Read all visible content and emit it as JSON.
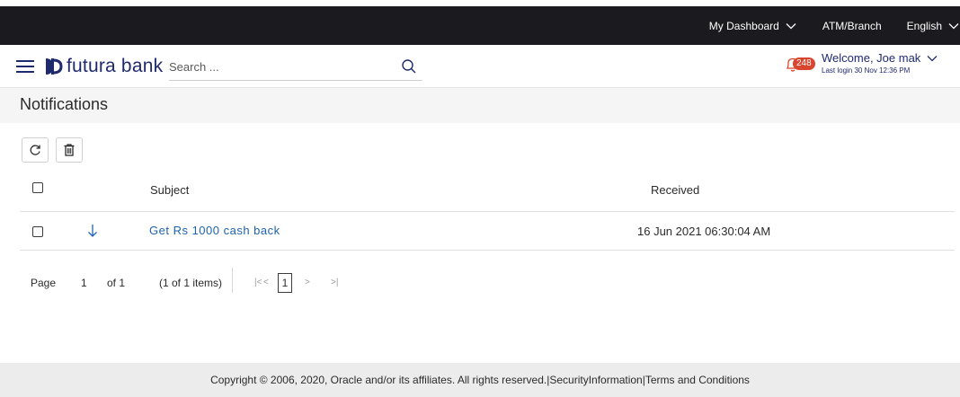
{
  "topbar": {
    "dashboard_label": "My Dashboard",
    "atm_branch_label": "ATM/Branch",
    "language_label": "English"
  },
  "header": {
    "brand_name": "futura bank",
    "search_placeholder": "Search ...",
    "notification_count": "248",
    "welcome_text": "Welcome, Joe mak",
    "last_login": "Last login 30 Nov 12:36 PM"
  },
  "page": {
    "title": "Notifications"
  },
  "toolbar": {
    "refresh_icon": "refresh-icon",
    "delete_icon": "trash-icon"
  },
  "table": {
    "columns": [
      "Subject",
      "Received"
    ],
    "rows": [
      {
        "direction_icon": "arrow-down-icon",
        "subject": "Get Rs 1000 cash back",
        "received": "16 Jun 2021 06:30:04 AM"
      }
    ]
  },
  "pagination": {
    "page_label": "Page",
    "current_page": "1",
    "of_label": "of 1",
    "items_summary": "(1 of 1 items)",
    "first_symbol": "|<",
    "prev_symbol": "<",
    "next_symbol": ">",
    "last_symbol": ">|"
  },
  "footer": {
    "copyright": "Copyright © 2006, 2020, Oracle and/or its affiliates. All rights reserved.",
    "security_link": "SecurityInformation",
    "terms_link": "Terms and Conditions",
    "separator": "|"
  },
  "colors": {
    "topbar_bg": "#1a1a1f",
    "brand_blue": "#1f2a6e",
    "link_blue": "#1e62b0",
    "badge_red": "#d8462f",
    "content_bg": "#f5f5f5",
    "footer_bg": "#ececec"
  }
}
